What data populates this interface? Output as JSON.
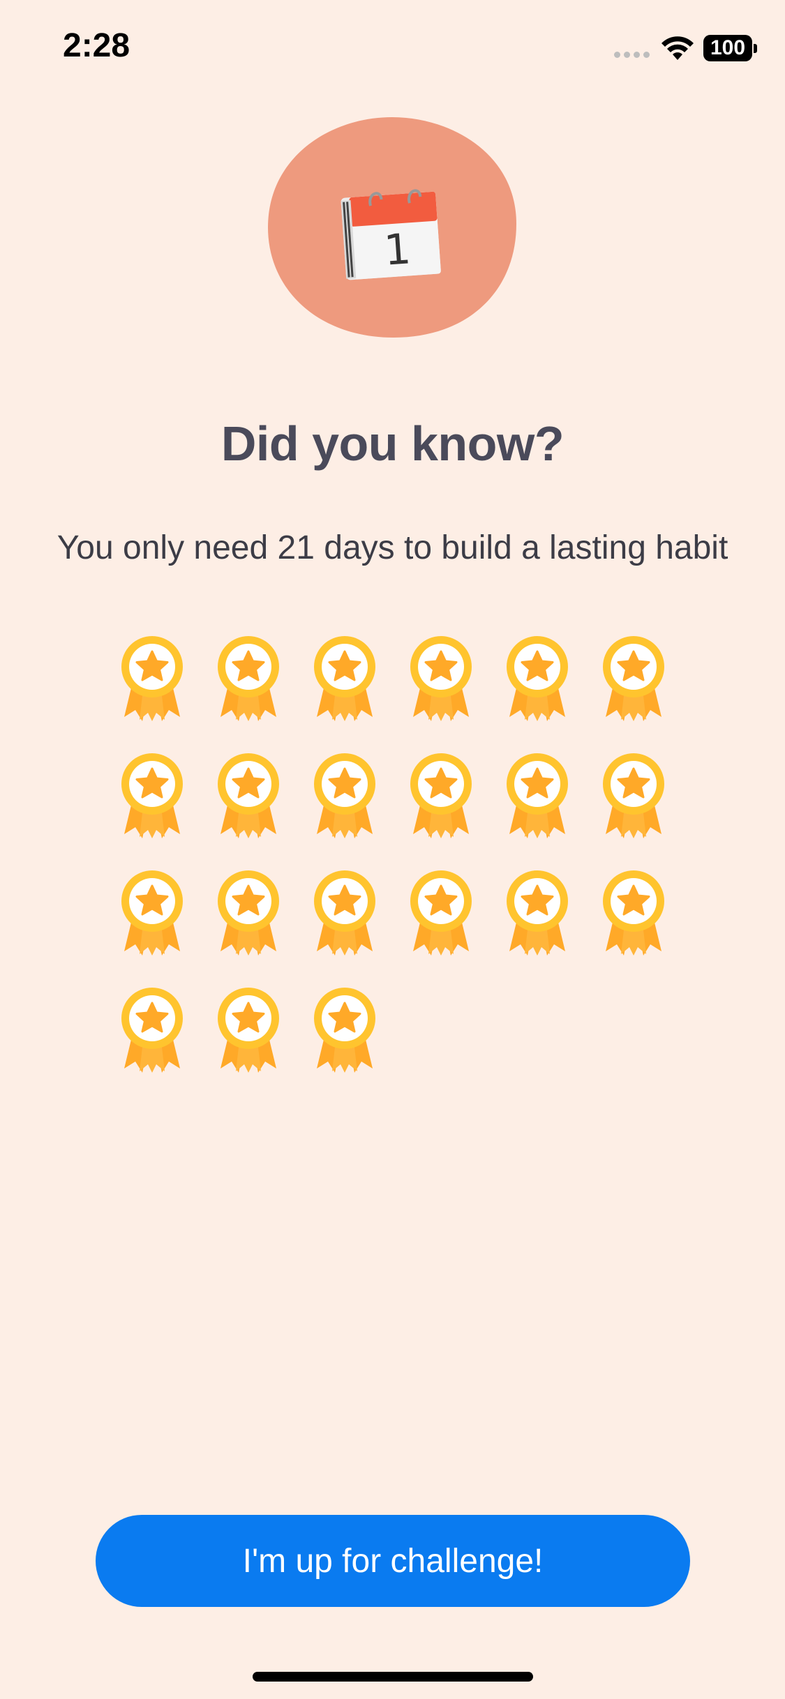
{
  "status_bar": {
    "time": "2:28",
    "battery": "100"
  },
  "hero": {
    "icon": "calendar-icon",
    "calendar_day": "1",
    "blob_color": "#EE9A7E",
    "calendar_header_color": "#F25C3F"
  },
  "headline": "Did you know?",
  "subtitle": "You only need 21 days to build a lasting habit",
  "medals": {
    "count": 21,
    "icon": "award-ribbon-icon",
    "colors": {
      "ribbon": "#FFA928",
      "ring": "#FFC42E",
      "center": "#FFFFFF",
      "star": "#FFA928"
    }
  },
  "cta": {
    "label": "I'm up for challenge!",
    "color": "#0A7BF0"
  },
  "colors": {
    "background": "#FDEEE5",
    "headline": "#4A4A5A"
  }
}
